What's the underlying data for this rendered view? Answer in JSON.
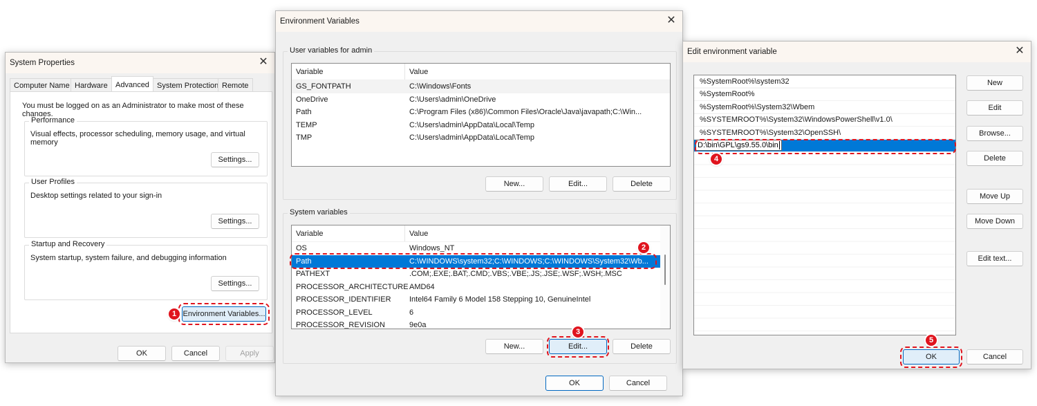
{
  "system_properties": {
    "title": "System Properties",
    "tabs": [
      {
        "label": "Computer Name",
        "active": false
      },
      {
        "label": "Hardware",
        "active": false
      },
      {
        "label": "Advanced",
        "active": true
      },
      {
        "label": "System Protection",
        "active": false
      },
      {
        "label": "Remote",
        "active": false
      }
    ],
    "admin_notice": "You must be logged on as an Administrator to make most of these changes.",
    "groups": [
      {
        "label": "Performance",
        "description": "Visual effects, processor scheduling, memory usage, and virtual memory",
        "button": "Settings..."
      },
      {
        "label": "User Profiles",
        "description": "Desktop settings related to your sign-in",
        "button": "Settings..."
      },
      {
        "label": "Startup and Recovery",
        "description": "System startup, system failure, and debugging information",
        "button": "Settings..."
      }
    ],
    "env_button": "Environment Variables...",
    "ok": "OK",
    "cancel": "Cancel",
    "apply": "Apply"
  },
  "env_vars": {
    "title": "Environment Variables",
    "user_group_label": "User variables for admin",
    "columns": {
      "variable": "Variable",
      "value": "Value"
    },
    "user_vars": [
      {
        "name": "GS_FONTPATH",
        "value": "C:\\Windows\\Fonts"
      },
      {
        "name": "OneDrive",
        "value": "C:\\Users\\admin\\OneDrive"
      },
      {
        "name": "Path",
        "value": "C:\\Program Files (x86)\\Common Files\\Oracle\\Java\\javapath;C:\\Win..."
      },
      {
        "name": "TEMP",
        "value": "C:\\Users\\admin\\AppData\\Local\\Temp"
      },
      {
        "name": "TMP",
        "value": "C:\\Users\\admin\\AppData\\Local\\Temp"
      }
    ],
    "user_buttons": {
      "new": "New...",
      "edit": "Edit...",
      "delete": "Delete"
    },
    "system_group_label": "System variables",
    "system_vars": [
      {
        "name": "OS",
        "value": "Windows_NT"
      },
      {
        "name": "Path",
        "value": "C:\\WINDOWS\\system32;C:\\WINDOWS;C:\\WINDOWS\\System32\\Wb..."
      },
      {
        "name": "PATHEXT",
        "value": ".COM;.EXE;.BAT;.CMD;.VBS;.VBE;.JS;.JSE;.WSF;.WSH;.MSC"
      },
      {
        "name": "PROCESSOR_ARCHITECTURE",
        "value": "AMD64"
      },
      {
        "name": "PROCESSOR_IDENTIFIER",
        "value": "Intel64 Family 6 Model 158 Stepping 10, GenuineIntel"
      },
      {
        "name": "PROCESSOR_LEVEL",
        "value": "6"
      },
      {
        "name": "PROCESSOR_REVISION",
        "value": "9e0a"
      }
    ],
    "system_buttons": {
      "new": "New...",
      "edit": "Edit...",
      "delete": "Delete"
    },
    "ok": "OK",
    "cancel": "Cancel"
  },
  "edit_env": {
    "title": "Edit environment variable",
    "entries": [
      "%SystemRoot%\\system32",
      "%SystemRoot%",
      "%SystemRoot%\\System32\\Wbem",
      "%SYSTEMROOT%\\System32\\WindowsPowerShell\\v1.0\\",
      "%SYSTEMROOT%\\System32\\OpenSSH\\"
    ],
    "editing_value": "D:\\bin\\GPL\\gs9.55.0\\bin",
    "buttons": {
      "new": "New",
      "edit": "Edit",
      "browse": "Browse...",
      "delete": "Delete",
      "move_up": "Move Up",
      "move_down": "Move Down",
      "edit_text": "Edit text..."
    },
    "ok": "OK",
    "cancel": "Cancel"
  },
  "steps": [
    "1",
    "2",
    "3",
    "4",
    "5"
  ],
  "icons": {
    "close": "✕"
  },
  "colors": {
    "highlight": "#e0141e",
    "selection": "#0078d7",
    "accent": "#0067c0"
  }
}
